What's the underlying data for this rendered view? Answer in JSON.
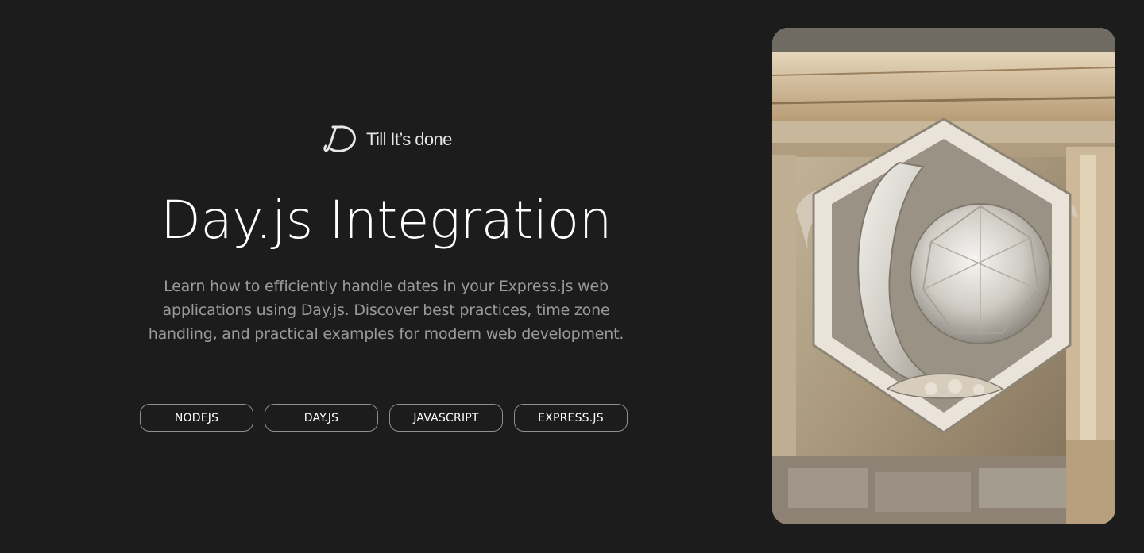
{
  "brand": {
    "name": "Till It’s done",
    "logo_icon": "dt-monogram-logo"
  },
  "hero": {
    "title": "Day.js Integration",
    "description": "Learn how to efficiently handle dates in your Express.js web applications using Day.js. Discover best practices, time zone handling, and practical examples for modern web development.",
    "tags": [
      "NODEJS",
      "DAY.JS",
      "JAVASCRIPT",
      "EXPRESS.JS"
    ],
    "image": {
      "subject": "stone-carved-dayjs-logo-illustration"
    }
  },
  "colors": {
    "background": "#1c1c1c",
    "text_primary": "#ffffff",
    "text_muted": "#9a9a9a",
    "tag_border": "#8f8f8f"
  }
}
